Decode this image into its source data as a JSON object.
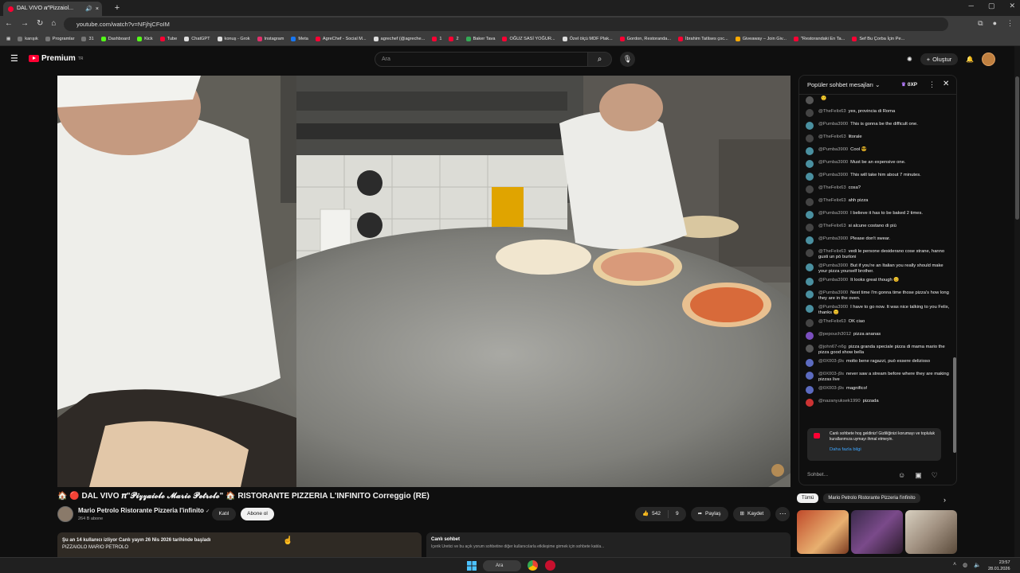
{
  "browser": {
    "tab_title": "DAL VIVO 𝝅\"Pizzaiol...",
    "new_tab": "+",
    "url": "youtube.com/watch?v=NFjhjCFoIM",
    "bookmarks": [
      {
        "label": "karışık",
        "color": "#777777"
      },
      {
        "label": "Programlar",
        "color": "#777777"
      },
      {
        "label": "31",
        "color": "#777777"
      },
      {
        "label": "Dashboard",
        "color": "#53fc18"
      },
      {
        "label": "Kick",
        "color": "#53fc18"
      },
      {
        "label": "Tube",
        "color": "#ff0033"
      },
      {
        "label": "ChatGPT",
        "color": "#dddddd"
      },
      {
        "label": "konuş - Grok",
        "color": "#dddddd"
      },
      {
        "label": "Instagram",
        "color": "#e1306c"
      },
      {
        "label": "Meta",
        "color": "#1877f2"
      },
      {
        "label": "AgreChef - Social M...",
        "color": "#ff0033"
      },
      {
        "label": "agrechef (@agreche...",
        "color": "#dddddd"
      },
      {
        "label": "1",
        "color": "#ff0033"
      },
      {
        "label": "2",
        "color": "#ff0033"
      },
      {
        "label": "Baker Tava",
        "color": "#33aa55"
      },
      {
        "label": "OĞUZ SASİ YOĞUR...",
        "color": "#ff0033"
      },
      {
        "label": "Özel ölçü MDF Plak...",
        "color": "#dddddd"
      },
      {
        "label": "Gordon, Restoranda...",
        "color": "#ff0033"
      },
      {
        "label": "İbrahim Tatlises çoc...",
        "color": "#ff0033"
      },
      {
        "label": "Giveaway – Join Giv...",
        "color": "#ffaa00"
      },
      {
        "label": "\"Restorandaki En Ta...",
        "color": "#ff0033"
      },
      {
        "label": "Sef Bu Çorba İçin Pe...",
        "color": "#ff0033"
      }
    ]
  },
  "yt": {
    "logo_text": "Premium",
    "logo_sup": "TR",
    "search_placeholder": "Ara",
    "create_label": "Oluştur"
  },
  "video": {
    "title": "🏠 🔴 DAL VIVO 𝝅\"𝓟𝓲𝔃𝔃𝓪𝓲𝓸𝓵𝓸 𝓜𝓪𝓻𝓲𝓸 𝓟𝓮𝓽𝓻𝓸𝓵𝓸\" 🏠 RISTORANTE PIZZERIA L'INFINITO Correggio (RE)",
    "channel": "Mario Petrolo Ristorante Pizzeria l'infinito",
    "verified": "✓",
    "subs": "264 B abone",
    "join": "Katıl",
    "subscribe": "Abone ol",
    "likes": "542",
    "viewers_count": "9",
    "share": "Paylaş",
    "save": "Kaydet",
    "description_line1": "Şu an 14 kullanıcı izliyor  Canlı yayın 26 Nis 2026 tarihinde başladı",
    "description_line2": "PIZZAIOLO MARIO PETROLO",
    "live_chat_label": "Canlı sohbet",
    "live_chat_sub": "İçerik Üretici ve bu açık yorum sohbetine diğer kullanıcılarla etkileşime girmek için sohbete katıla..."
  },
  "chat": {
    "title": "Popüler sohbet mesajları",
    "xp": "0XP",
    "messages": [
      {
        "user": "",
        "text": "🙂",
        "color": "#555555"
      },
      {
        "user": "@TheFelix63",
        "text": "yes, provincia di Roma",
        "color": "#444444"
      },
      {
        "user": "@Pumba3900",
        "text": "This is gonna be the difficult one.",
        "color": "#4a90a0"
      },
      {
        "user": "@TheFelix63",
        "text": "litorale",
        "color": "#444444"
      },
      {
        "user": "@Pumba3900",
        "text": "Cool 😎",
        "color": "#4a90a0"
      },
      {
        "user": "@Pumba3900",
        "text": "Must be an expensive one.",
        "color": "#4a90a0"
      },
      {
        "user": "@Pumba3900",
        "text": "This will take him about 7 minutes.",
        "color": "#4a90a0"
      },
      {
        "user": "@TheFelix63",
        "text": "cosa?",
        "color": "#444444"
      },
      {
        "user": "@TheFelix63",
        "text": "ahh pizza",
        "color": "#444444"
      },
      {
        "user": "@Pumba3900",
        "text": "I believe it has to be baked 2 times.",
        "color": "#4a90a0"
      },
      {
        "user": "@TheFelix63",
        "text": "si alcune costano di più",
        "color": "#444444"
      },
      {
        "user": "@Pumba3900",
        "text": "Please don't swear.",
        "color": "#4a90a0"
      },
      {
        "user": "@TheFelix63",
        "text": "vedi le persone desiderano cose strane, hanno gusti un pò burloni",
        "color": "#444444"
      },
      {
        "user": "@Pumba3900",
        "text": "But if you're an Italian you really should make your pizza yourself brother.",
        "color": "#4a90a0"
      },
      {
        "user": "@Pumba3900",
        "text": "It looks great though 😊",
        "color": "#4a90a0"
      },
      {
        "user": "@Pumba3900",
        "text": "Next time I'm gonna time those pizza's how long they are in the oven.",
        "color": "#4a90a0"
      },
      {
        "user": "@Pumba3900",
        "text": "I have to go now. It was nice talking to you Felix, thanks 😊",
        "color": "#4a90a0"
      },
      {
        "user": "@TheFelix63",
        "text": "OK ciao",
        "color": "#444444"
      },
      {
        "user": "@pepouch3012",
        "text": "pizza ananas",
        "color": "#7b4fbf"
      },
      {
        "user": "@john67-n6g",
        "text": "pizza granda speciale pizza di mama mario the pizza good show bella",
        "color": "#555555"
      },
      {
        "user": "@0X003-j9s",
        "text": "molto bene ragazzi, può essere delizioso",
        "color": "#5c6bc0"
      },
      {
        "user": "@0X003-j9s",
        "text": "never saw a stream before where they are making pizzas live",
        "color": "#5c6bc0"
      },
      {
        "user": "@0X003-j9s",
        "text": "magnifico!",
        "color": "#5c6bc0"
      },
      {
        "user": "@nazanyuksek1990",
        "text": "pizzada",
        "color": "#cc3333"
      }
    ],
    "welcome_text": "Canlı sohbete hoş geldiniz! Gizliliğinizi korumayı ve topluluk kurallarımıza uymayı ihmal etmeyin.",
    "welcome_link": "Daha fazla bilgi",
    "input_placeholder": "Sohbet..."
  },
  "recs": {
    "chip_all": "Tümü",
    "chip_channel": "Mario Petrolo Ristorante Pizzeria l'infinito"
  },
  "taskbar": {
    "search": "Ara",
    "time": "23:57",
    "date": "28.01.2026"
  }
}
